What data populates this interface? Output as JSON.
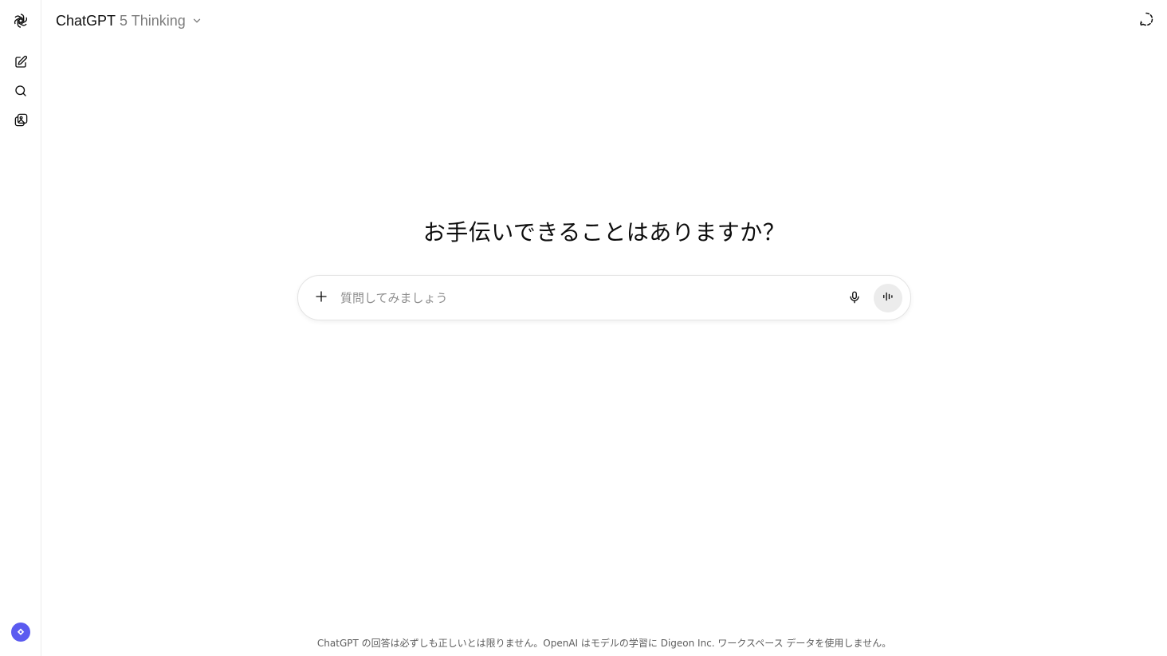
{
  "rail": {
    "logo_icon": "openai-logo-icon",
    "new_chat_icon": "new-chat-icon",
    "search_icon": "search-icon",
    "library_icon": "library-icon",
    "upgrade_icon": "upgrade-badge-icon",
    "upgrade_color": "#5b5bf0"
  },
  "header": {
    "model_name": "ChatGPT",
    "model_variant": "5 Thinking",
    "switcher_icon": "chevron-down-icon",
    "temp_chat_icon": "temporary-chat-icon"
  },
  "main": {
    "headline": "お手伝いできることはありますか？"
  },
  "composer": {
    "placeholder": "質問してみましょう",
    "value": "",
    "attach_icon": "plus-icon",
    "mic_icon": "microphone-icon",
    "voice_icon": "voice-mode-icon"
  },
  "footer": {
    "disclaimer": "ChatGPT の回答は必ずしも正しいとは限りません。OpenAI はモデルの学習に Digeon Inc. ワークスペース データを使用しません。"
  }
}
